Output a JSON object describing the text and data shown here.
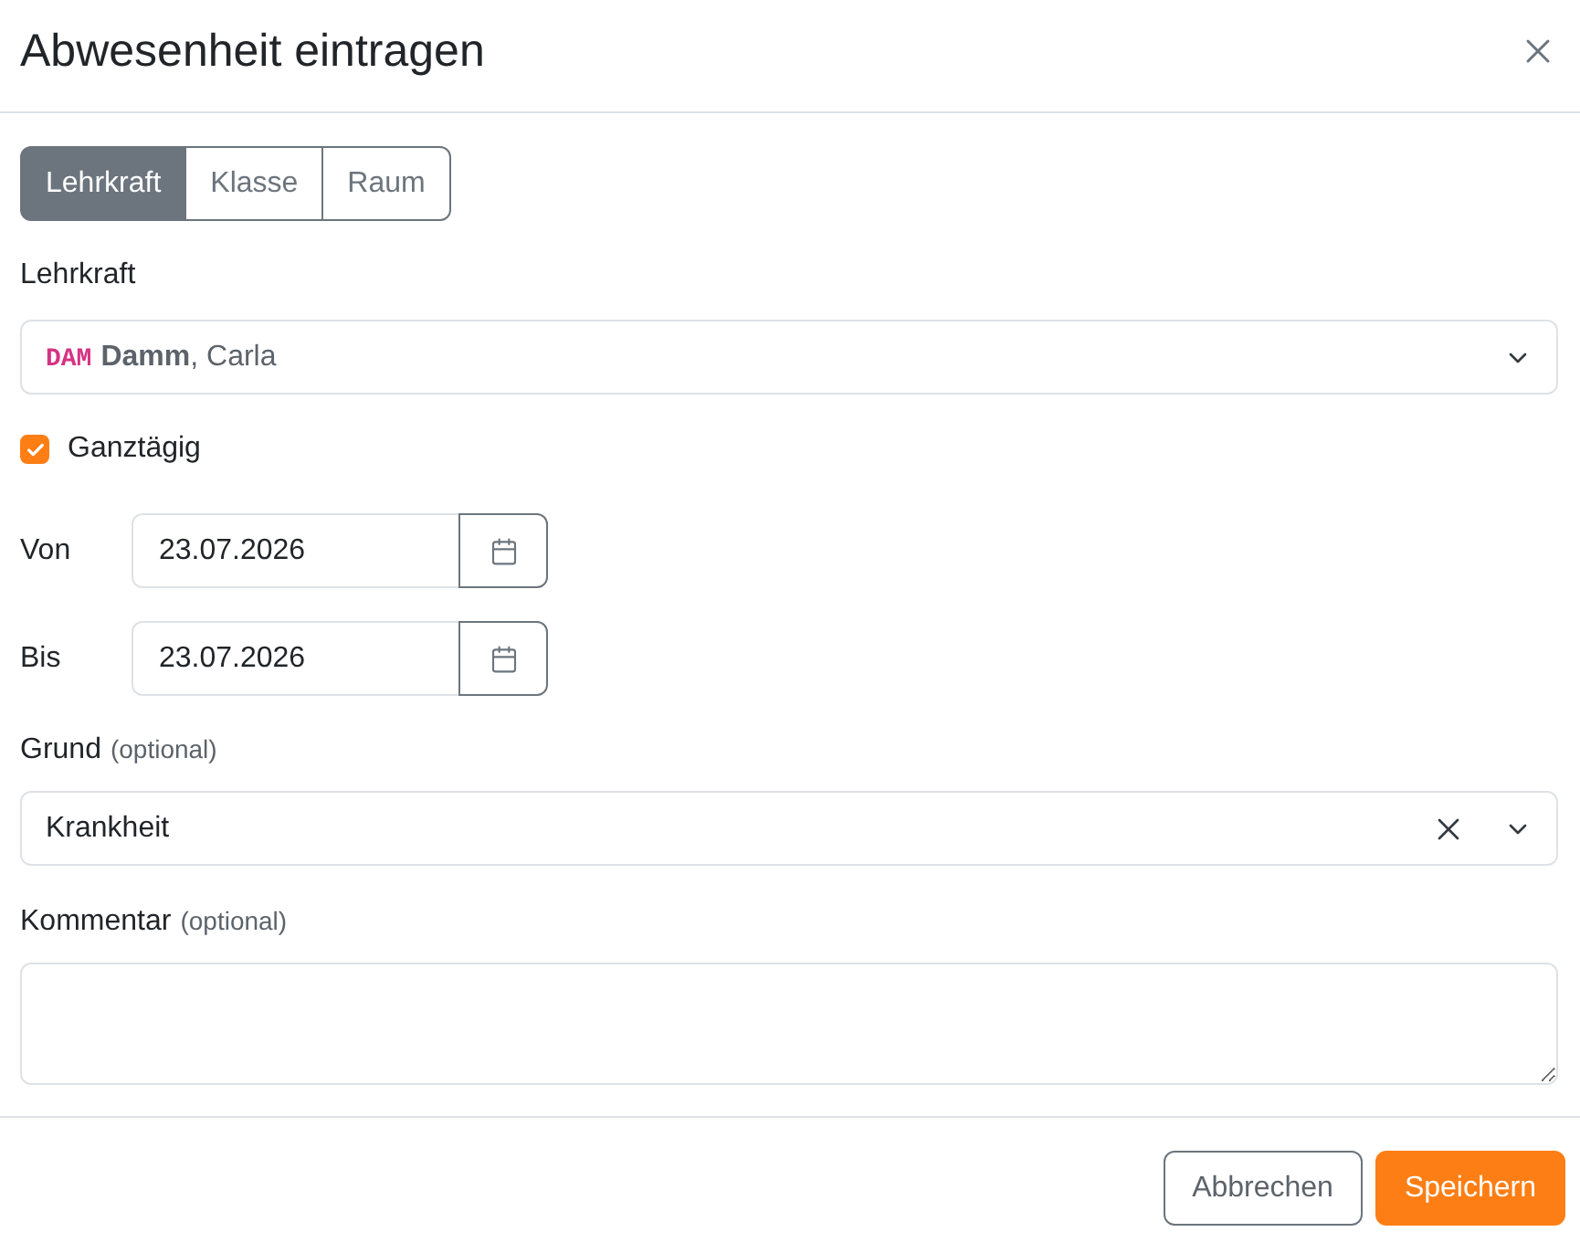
{
  "dialog": {
    "title": "Abwesenheit eintragen"
  },
  "tabs": [
    {
      "label": "Lehrkraft",
      "selected": true
    },
    {
      "label": "Klasse",
      "selected": false
    },
    {
      "label": "Raum",
      "selected": false
    }
  ],
  "teacher": {
    "label": "Lehrkraft",
    "code": "DAM",
    "name": "**Damm**, Carla"
  },
  "all_day": {
    "label": "Ganztägig",
    "checked": true
  },
  "dates": [
    {
      "label": "Von",
      "value": "23.07.2026"
    },
    {
      "label": "Bis",
      "value": "23.07.2026"
    }
  ],
  "reason": {
    "label": "Grund",
    "hint": "(optional)",
    "value": "Krankheit",
    "clearable": true
  },
  "comment": {
    "label": "Kommentar",
    "hint": "(optional)"
  },
  "buttons": [
    {
      "label": "Abbrechen",
      "kind": "secondary"
    },
    {
      "label": "Speichern",
      "kind": "primary"
    }
  ]
}
